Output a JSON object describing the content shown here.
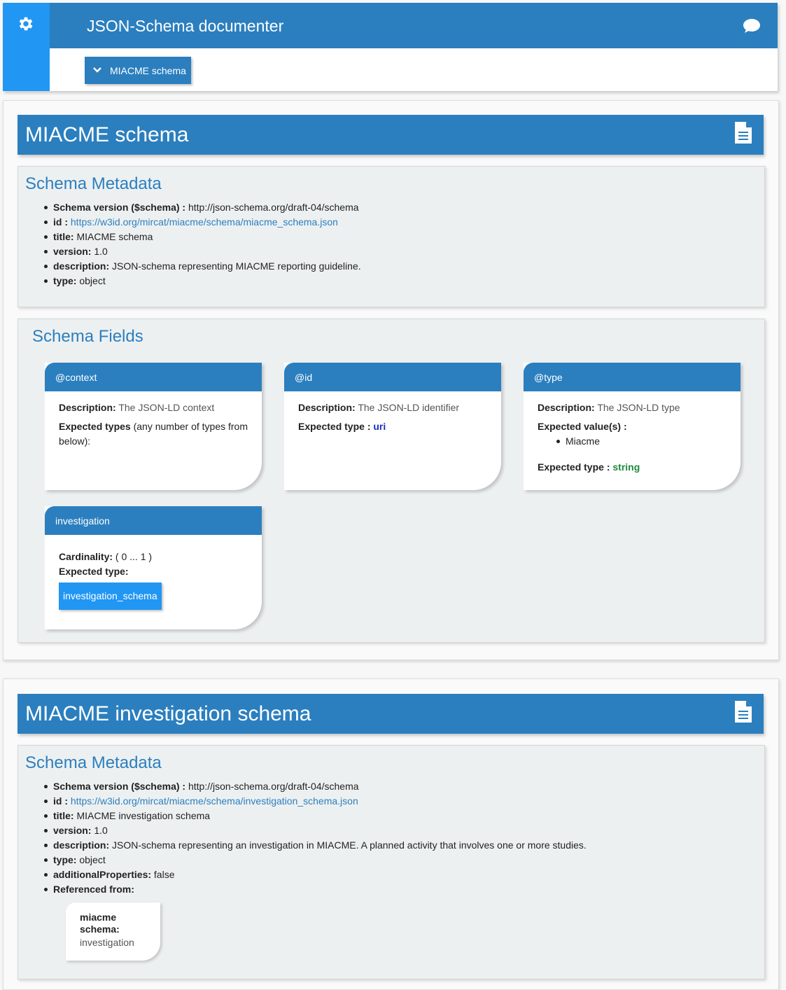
{
  "app": {
    "title": "JSON-Schema documenter",
    "dropdown_label": "MIACME schema"
  },
  "schemas": [
    {
      "title": "MIACME schema",
      "metadata_heading": "Schema Metadata",
      "metadata": {
        "schema_version_label": "Schema version ($schema) :",
        "schema_version": "http://json-schema.org/draft-04/schema",
        "id_label": "id :",
        "id": "https://w3id.org/mircat/miacme/schema/miacme_schema.json",
        "title_label": "title:",
        "title": "MIACME schema",
        "version_label": "version:",
        "version": "1.0",
        "description_label": "description:",
        "description": "JSON-schema representing MIACME reporting guideline.",
        "type_label": "type:",
        "type": "object"
      },
      "fields_heading": "Schema Fields",
      "fields": [
        {
          "name": "@context",
          "description_label": "Description:",
          "description": "The JSON-LD context",
          "expected_types_label": "Expected types",
          "expected_types_note": "(any number of types from below):"
        },
        {
          "name": "@id",
          "description_label": "Description:",
          "description": "The JSON-LD identifier",
          "expected_type_label": "Expected type :",
          "expected_type": "uri"
        },
        {
          "name": "@type",
          "description_label": "Description:",
          "description": "The JSON-LD type",
          "expected_values_label": "Expected value(s) :",
          "expected_value": "Miacme",
          "expected_type_label": "Expected type :",
          "expected_type": "string"
        },
        {
          "name": "investigation",
          "cardinality_label": "Cardinality:",
          "cardinality": "( 0 ... 1 )",
          "expected_type_label": "Expected type:",
          "expected_type_button": "investigation_schema"
        }
      ]
    },
    {
      "title": "MIACME investigation schema",
      "metadata_heading": "Schema Metadata",
      "metadata": {
        "schema_version_label": "Schema version ($schema) :",
        "schema_version": "http://json-schema.org/draft-04/schema",
        "id_label": "id :",
        "id": "https://w3id.org/mircat/miacme/schema/investigation_schema.json",
        "title_label": "title:",
        "title": "MIACME investigation schema",
        "version_label": "version:",
        "version": "1.0",
        "description_label": "description:",
        "description": "JSON-schema representing an investigation in MIACME. A planned activity that involves one or more studies.",
        "type_label": "type:",
        "type": "object",
        "additional_label": "additionalProperties:",
        "additional": "false",
        "referenced_label": "Referenced from:"
      },
      "referenced_from": {
        "schema_line1": "miacme",
        "schema_line2": "schema:",
        "field": "investigation"
      }
    }
  ],
  "icons": {
    "gear": "gear-icon",
    "chat": "chat-icon",
    "chevron": "chevron-down-icon",
    "document": "document-icon"
  },
  "colors": {
    "primary": "#2b7fbf",
    "accent": "#2196f3",
    "uri": "#1a2fbf",
    "string": "#1e8a3c"
  }
}
